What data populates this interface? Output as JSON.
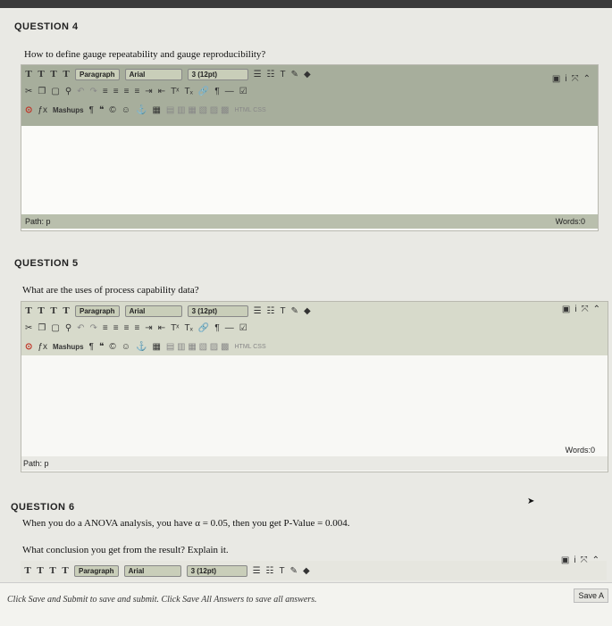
{
  "questions": [
    {
      "heading": "QUESTION 4",
      "text": "How to define gauge repeatability and gauge reproducibility?",
      "path": "Path: p",
      "words": "Words:0"
    },
    {
      "heading": "QUESTION 5",
      "text": "What are the uses of process capability data?",
      "path": "Path: p",
      "words": "Words:0"
    },
    {
      "heading": "QUESTION 6",
      "text_line1": "When you do a ANOVA analysis, you have α = 0.05, then you get P-Value = 0.004.",
      "text_line2": "What conclusion you get from the result? Explain it."
    }
  ],
  "toolbar": {
    "format_buttons": [
      "T",
      "T",
      "T",
      "T"
    ],
    "paragraph": "Paragraph",
    "font": "Arial",
    "size": "3 (12pt)",
    "mashups": "Mashups",
    "html_css": "HTML CSS"
  },
  "footer": {
    "instructions": "Click Save and Submit to save and submit. Click Save All Answers to save all answers.",
    "save_label": "Save A"
  },
  "colors": {
    "toolbar_bg": "#a7ae9c",
    "path_bg": "#b9bfad",
    "editor_bg": "#fbfbf9"
  }
}
